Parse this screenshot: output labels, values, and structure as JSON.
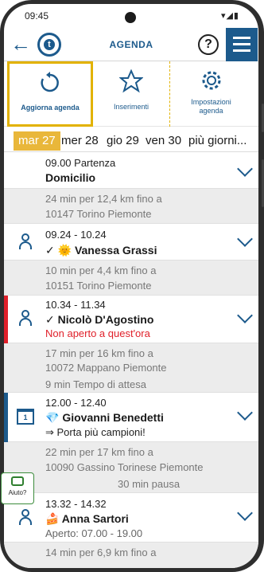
{
  "status": {
    "time": "09:45",
    "icons": "▾◢▮"
  },
  "header": {
    "title": "AGENDA",
    "logo_letter": "t",
    "help_label": "?"
  },
  "toolbar": [
    {
      "label": "Aggiorna agenda",
      "icon": "refresh-icon"
    },
    {
      "label": "Inserimenti",
      "icon": "star-icon"
    },
    {
      "label": "Impostazioni agenda",
      "icon": "gear-icon"
    }
  ],
  "dates": [
    "mar 27",
    "mer 28",
    "gio 29",
    "ven 30",
    "più giorni..."
  ],
  "agenda": {
    "start": {
      "time": "09.00 Partenza",
      "place": "Domicilio"
    },
    "t1": {
      "line1": "24 min per 12,4 km fino a",
      "line2": "10147 Torino Piemonte"
    },
    "a1": {
      "time": "09.24 - 10.24",
      "name": "✓ 🌞 Vanessa Grassi"
    },
    "t2": {
      "line1": "10 min per 4,4 km fino a",
      "line2": "10151 Torino Piemonte"
    },
    "a2": {
      "time": "10.34 - 11.34",
      "name": "✓ Nicolò D'Agostino",
      "note": "Non aperto a quest'ora"
    },
    "t3": {
      "line1": "17 min per 16 km fino a",
      "line2": "10072 Mappano Piemonte",
      "line3": "9 min Tempo di attesa"
    },
    "a3": {
      "time": "12.00 - 12.40",
      "name": "💎 Giovanni Benedetti",
      "note": "⇒ Porta più campioni!"
    },
    "t4": {
      "line1": "22 min per 17 km fino a",
      "line2": "10090 Gassino Torinese Piemonte",
      "line3": "30 min pausa"
    },
    "a4": {
      "time": "13.32 - 14.32",
      "name": "🍰 Anna Sartori",
      "note": "Aperto: 07.00 - 19.00"
    },
    "t5": {
      "line1": "14 min per 6,9 km fino a"
    }
  },
  "aiuto_label": "Aiuto?",
  "colors": {
    "brand": "#1c5a8c",
    "highlight": "#e2b200",
    "alert": "#e0202a",
    "date_active": "#e9b73a"
  }
}
